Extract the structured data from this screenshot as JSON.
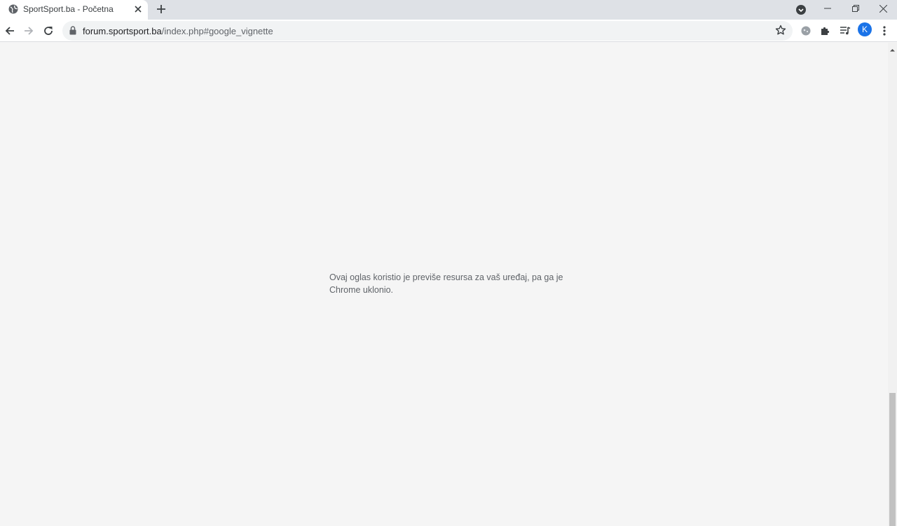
{
  "browser": {
    "tab": {
      "title": "SportSport.ba - Početna"
    },
    "address": {
      "domain": "forum.sportsport.ba",
      "path": "/index.php#google_vignette"
    },
    "profile_initial": "K"
  },
  "page": {
    "message": "Ovaj oglas koristio je previše resursa za vaš uređaj, pa ga je Chrome uklonio."
  },
  "colors": {
    "tabstrip_bg": "#dee1e6",
    "page_bg": "#f5f5f5",
    "avatar_bg": "#1a73e8",
    "message_text": "#5f6368"
  }
}
